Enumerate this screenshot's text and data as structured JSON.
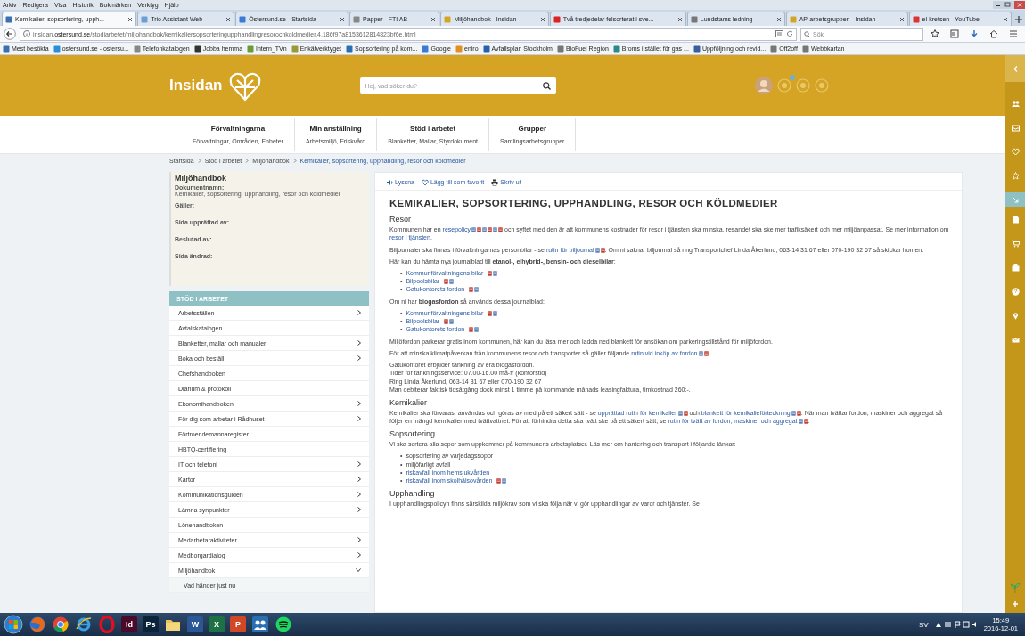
{
  "browser": {
    "menu": [
      "Arkiv",
      "Redigera",
      "Visa",
      "Historik",
      "Bokmärken",
      "Verktyg",
      "Hjälp"
    ],
    "tabs": [
      {
        "title": "Kemikalier, sopsortering, upph...",
        "selected": true
      },
      {
        "title": "Trio Assistant Web",
        "selected": false
      },
      {
        "title": "Östersund.se - Startsida",
        "selected": false
      },
      {
        "title": "Papper - FTI AB",
        "selected": false
      },
      {
        "title": "Miljöhandbok - Insidan",
        "selected": false
      },
      {
        "title": "Två tredjedelar felsorterat i sve...",
        "selected": false
      },
      {
        "title": "Lundstams ledning",
        "selected": false
      },
      {
        "title": "AP-arbetsgruppen - Insidan",
        "selected": false
      },
      {
        "title": "el-kretsen - YouTube",
        "selected": false
      }
    ],
    "url": "insidan.**ostersund.se**/stodiarbetet/miljohandbok/kemikaliersopsorteringupphandlingresorochkoldmedier.4.186f97a8153612814823bf6e.html",
    "search": {
      "placeholder": "Sök"
    },
    "bookmarks": [
      "Mest besökta",
      "ostersund.se - ostersu...",
      "Telefonkatalogen",
      "Jobba hemma",
      "Intern_TVn",
      "Enkätverktyget",
      "Sopsortering på kom...",
      "Google",
      "eniro",
      "Avfallsplan Stockholm",
      "BioFuel Region",
      "Broms i stället för gas ...",
      "Uppföljning och revid...",
      "Off2off",
      "Webbkartan"
    ]
  },
  "header": {
    "logo": "Insidan",
    "search": {
      "placeholder": "Hej, vad söker du?"
    }
  },
  "nav": [
    {
      "title": "Förvaltningarna",
      "subtitle": "Förvaltningar, Områden, Enheter"
    },
    {
      "title": "Min anställning",
      "subtitle": "Arbetsmiljö, Friskvård"
    },
    {
      "title": "Stöd i arbetet",
      "subtitle": "Blanketter, Mallar, Styrdokument"
    },
    {
      "title": "Grupper",
      "subtitle": "Samlingsarbetsgrupper"
    }
  ],
  "breadcrumb": [
    {
      "label": "Startsida",
      "current": false
    },
    {
      "label": "Stöd i arbetet",
      "current": false
    },
    {
      "label": "Miljöhandbok",
      "current": false
    },
    {
      "label": "Kemikalier, sopsortering, upphandling, resor och köldmedier",
      "current": true
    }
  ],
  "doc_info": {
    "title": "Miljöhandbok",
    "fields": [
      {
        "label": "Dokumentnamn:",
        "value": "Kemikalier, sopsortering, upphandling, resor och köldmedier"
      },
      {
        "label": "Gäller:"
      },
      {
        "label": "Sida upprättad av:"
      },
      {
        "label": "Beslutad av:"
      },
      {
        "label": "Sida ändrad:"
      }
    ]
  },
  "side_menu": {
    "heading": "STÖD I ARBETET",
    "items": [
      {
        "label": "Arbetsställen",
        "expandable": true,
        "expanded": false
      },
      {
        "label": "Avtalskatalogen",
        "expandable": false
      },
      {
        "label": "Blanketter, mallar och manualer",
        "expandable": true,
        "expanded": false
      },
      {
        "label": "Boka och beställ",
        "expandable": true,
        "expanded": false
      },
      {
        "label": "Chefshandboken",
        "expandable": false
      },
      {
        "label": "Diarium & protokoll",
        "expandable": false
      },
      {
        "label": "Ekonomihandboken",
        "expandable": true,
        "expanded": false
      },
      {
        "label": "För dig som arbetar i Rådhuset",
        "expandable": true,
        "expanded": false
      },
      {
        "label": "Förtroendemannaregister",
        "expandable": false
      },
      {
        "label": "HBTQ-certifiering",
        "expandable": false
      },
      {
        "label": "IT och telefoni",
        "expandable": true,
        "expanded": false
      },
      {
        "label": "Kartor",
        "expandable": true,
        "expanded": false
      },
      {
        "label": "Kommunikationsguiden",
        "expandable": true,
        "expanded": false
      },
      {
        "label": "Lämna synpunkter",
        "expandable": true,
        "expanded": false
      },
      {
        "label": "Lönehandboken",
        "expandable": false
      },
      {
        "label": "Medarbetaraktiviteter",
        "expandable": true,
        "expanded": false
      },
      {
        "label": "Medborgardialog",
        "expandable": true,
        "expanded": false
      },
      {
        "label": "Miljöhandbok",
        "expandable": true,
        "expanded": true,
        "children": [
          {
            "label": "Vad händer just nu",
            "expandable": false
          }
        ]
      }
    ]
  },
  "article": {
    "actions": [
      "Lyssna",
      "Lägg till som favorit",
      "Skriv ut"
    ],
    "title": "KEMIKALIER, SOPSORTERING, UPPHANDLING, RESOR OCH KÖLDMEDIER",
    "blocks": [
      {
        "kind": "heading",
        "text": "Resor"
      },
      {
        "kind": "paragraph",
        "parts": [
          {
            "kind": "text",
            "text": "Kommunen har en "
          },
          {
            "kind": "link",
            "text": "resepolicy",
            "icons": [
              {
                "kind": "doc"
              },
              {
                "kind": "pdf"
              },
              {
                "kind": "doc"
              },
              {
                "kind": "pdf"
              },
              {
                "kind": "doc"
              },
              {
                "kind": "pdf"
              }
            ]
          },
          {
            "kind": "text",
            "text": " och syftet med den är att kommunens kostnader för resor i tjänsten ska minska, resandet ska ske mer trafiksäkert och mer miljöanpassat. Se mer information om "
          },
          {
            "kind": "link",
            "text": "resor i tjänsten"
          },
          {
            "kind": "text",
            "text": "."
          }
        ]
      },
      {
        "kind": "paragraph",
        "parts": [
          {
            "kind": "text",
            "text": "Biljournaler ska finnas i förvaltningarnas personbilar - se "
          },
          {
            "kind": "link",
            "text": "rutin för biljournal",
            "icons": [
              {
                "kind": "doc"
              },
              {
                "kind": "pdf"
              }
            ]
          },
          {
            "kind": "text",
            "text": ". Om ni saknar biljournal så ring Transportchef Linda Åkerlund, 063-14 31 67 eller 070-190 32 67 så skickar hon en."
          }
        ]
      },
      {
        "kind": "paragraph",
        "parts": [
          {
            "kind": "text",
            "text": "Här kan du hämta nya journalblad till **etanol-, elhybrid-, bensin- och dieselbilar**:"
          }
        ]
      },
      {
        "kind": "list",
        "marker": "•",
        "items": [
          {
            "text": "Kommunförvaltningens bilar",
            "link": true,
            "icons": [
              {
                "kind": "pdf"
              },
              {
                "kind": "doc"
              }
            ]
          },
          {
            "text": "Bilpoolsbilar",
            "link": true,
            "icons": [
              {
                "kind": "pdf"
              },
              {
                "kind": "doc"
              }
            ]
          },
          {
            "text": "Gatukontorets fordon",
            "link": true,
            "icons": [
              {
                "kind": "pdf"
              },
              {
                "kind": "doc"
              }
            ]
          }
        ]
      },
      {
        "kind": "paragraph",
        "parts": [
          {
            "kind": "text",
            "text": "Om ni har **biogasfordon** så används dessa journalblad:"
          }
        ]
      },
      {
        "kind": "list",
        "marker": "•",
        "items": [
          {
            "text": "Kommunförvaltningens bilar",
            "link": true,
            "icons": [
              {
                "kind": "pdf"
              },
              {
                "kind": "doc"
              }
            ]
          },
          {
            "text": "Bilpoolsbilar",
            "link": true,
            "icons": [
              {
                "kind": "pdf"
              },
              {
                "kind": "doc"
              }
            ]
          },
          {
            "text": "Gatukontorets fordon",
            "link": true,
            "icons": [
              {
                "kind": "pdf"
              },
              {
                "kind": "doc"
              }
            ]
          }
        ]
      },
      {
        "kind": "paragraph",
        "parts": [
          {
            "kind": "text",
            "text": "Miljöfordon parkerar gratis inom kommunen, här kan du läsa mer och ladda ned blankett för ansökan om parkeringstillstånd för miljöfordon."
          }
        ]
      },
      {
        "kind": "paragraph",
        "parts": [
          {
            "kind": "text",
            "text": "För att minska klimatpåverkan från kommunens resor och transporter så gäller följande "
          },
          {
            "kind": "link",
            "text": "rutin vid inköp av fordon",
            "icons": [
              {
                "kind": "doc"
              },
              {
                "kind": "pdf"
              }
            ]
          },
          {
            "kind": "text",
            "text": "."
          }
        ]
      },
      {
        "kind": "lines",
        "lines": [
          "Gatukontoret erbjuder tankning av era biogasfordon.",
          "Tider för tankningsservice: 07.00-16.00 må-fr (kontorstid)",
          "Ring Linda Åkerlund, 063-14 31 67 eller 070-190 32 67",
          "Man debiterar faktisk tidsåtgång dock minst 1 timme på kommande månads leasingfaktura, timkostnad 260:-."
        ]
      },
      {
        "kind": "heading",
        "text": "Kemikalier"
      },
      {
        "kind": "paragraph",
        "parts": [
          {
            "kind": "text",
            "text": "Kemikalier ska förvaras, användas och göras av med på ett säkert sätt - se "
          },
          {
            "kind": "link",
            "text": "upprättad rutin för kemikalier",
            "icons": [
              {
                "kind": "doc"
              },
              {
                "kind": "pdf"
              }
            ]
          },
          {
            "kind": "text",
            "text": " och "
          },
          {
            "kind": "link",
            "text": "blankett för kemikalieförteckning",
            "icons": [
              {
                "kind": "doc"
              },
              {
                "kind": "pdf"
              }
            ]
          },
          {
            "kind": "text",
            "text": ". När man tvättar fordon, maskiner och aggregat så följer en mängd kemikalier med tvättvattnet. För att förhindra detta ska tvätt ske på ett säkert sätt, se "
          },
          {
            "kind": "link",
            "text": "rutin för tvätt av fordon, maskiner och aggregat",
            "icons": [
              {
                "kind": "doc"
              },
              {
                "kind": "pdf"
              }
            ]
          },
          {
            "kind": "text",
            "text": "."
          }
        ]
      },
      {
        "kind": "heading",
        "text": "Sopsortering"
      },
      {
        "kind": "paragraph",
        "parts": [
          {
            "kind": "text",
            "text": "Vi ska sortera alla sopor som uppkommer på kommunens arbetsplatser. Läs mer om hantering och transport i följande länkar:"
          }
        ]
      },
      {
        "kind": "list",
        "marker": "•",
        "items": [
          {
            "text": "sopsortering av varjedagssopor",
            "link": false
          },
          {
            "text": "miljöfarligt avfall",
            "link": false
          },
          {
            "text": "riskavfall inom hemsjukvården",
            "link": true
          },
          {
            "text": "riskavfall inom skolhälsovården",
            "link": true,
            "icons": [
              {
                "kind": "pdf"
              },
              {
                "kind": "doc"
              }
            ]
          }
        ]
      },
      {
        "kind": "heading",
        "text": "Upphandling"
      },
      {
        "kind": "paragraph",
        "parts": [
          {
            "kind": "text",
            "text": "I upphandlingspolicyn finns särskilda miljökrav som vi ska följa när vi gör upphandlingar av varor och tjänster. Se"
          }
        ]
      }
    ]
  },
  "taskbar": {
    "apps": [
      {
        "kind": "firefox"
      },
      {
        "kind": "chrome"
      },
      {
        "kind": "ie"
      },
      {
        "kind": "opera"
      },
      {
        "kind": "letter",
        "label": "Id",
        "color": "#4a0a2a"
      },
      {
        "kind": "letter",
        "label": "Ps",
        "color": "#0b2338"
      },
      {
        "kind": "folder"
      },
      {
        "kind": "letter",
        "label": "W",
        "color": "#2b5797"
      },
      {
        "kind": "letter",
        "label": "X",
        "color": "#1e7145"
      },
      {
        "kind": "letter",
        "label": "P",
        "color": "#d24726"
      },
      {
        "kind": "people"
      },
      {
        "kind": "spotify"
      }
    ],
    "language": "SV",
    "time": "15:49",
    "date": "2016-12-01"
  }
}
